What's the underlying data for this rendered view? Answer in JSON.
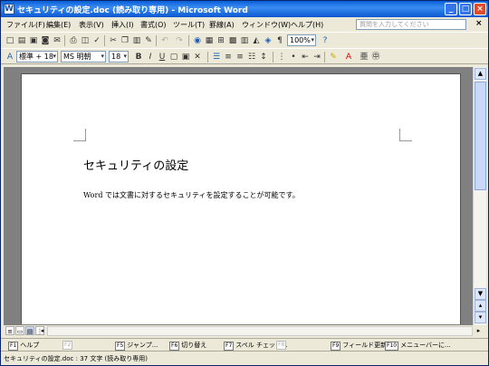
{
  "window": {
    "title": "セキュリティの設定.doc (読み取り専用) - Microsoft Word"
  },
  "menubar": {
    "items": [
      "ファイル(F)",
      "編集(E)",
      "表示(V)",
      "挿入(I)",
      "書式(O)",
      "ツール(T)",
      "罫線(A)",
      "ウィンドウ(W)",
      "ヘルプ(H)"
    ],
    "help_placeholder": "質問を入力してください",
    "close": "×"
  },
  "toolbar_standard": {
    "zoom": "100%"
  },
  "toolbar_format": {
    "style": "標準 + 18",
    "font": "MS 明朝",
    "size": "18",
    "bold": "B",
    "italic": "I",
    "underline": "U"
  },
  "document": {
    "heading": "セキュリティの設定",
    "body": "Word では文書に対するセキュリティを設定することが可能です。"
  },
  "fkeys": [
    {
      "key": "F1",
      "label": "ヘルプ",
      "enabled": true
    },
    {
      "key": "F2",
      "label": "",
      "enabled": false
    },
    {
      "key": "F5",
      "label": "ジャンプ...",
      "enabled": true
    },
    {
      "key": "F6",
      "label": "切り替え",
      "enabled": true
    },
    {
      "key": "F7",
      "label": "スペル チェック...",
      "enabled": true
    },
    {
      "key": "F8",
      "label": "",
      "enabled": false
    },
    {
      "key": "F9",
      "label": "フィールド更新",
      "enabled": true
    },
    {
      "key": "F10",
      "label": "メニューバーに...",
      "enabled": true
    }
  ],
  "statusbar": {
    "text": "セキュリティの設定.doc : 37 文字 (読み取り専用)"
  }
}
